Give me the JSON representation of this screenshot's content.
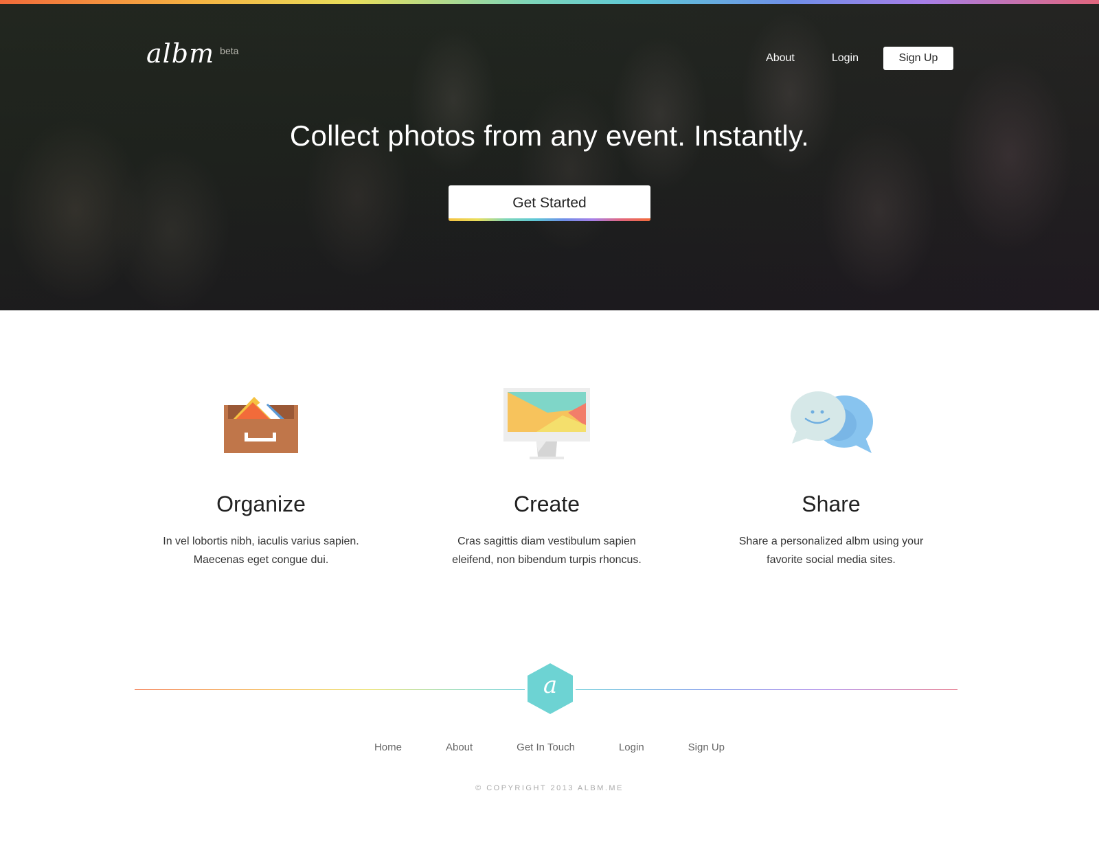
{
  "brand": {
    "name": "albm",
    "tag": "beta"
  },
  "nav": {
    "about": "About",
    "login": "Login",
    "signup": "Sign Up"
  },
  "hero": {
    "headline": "Collect photos from any event. Instantly.",
    "cta": "Get Started"
  },
  "features": [
    {
      "title": "Organize",
      "line1": "In vel lobortis nibh, iaculis varius sapien.",
      "line2": "Maecenas eget congue dui.",
      "icon": "photo-drawer-icon"
    },
    {
      "title": "Create",
      "line1": "Cras sagittis diam vestibulum sapien",
      "line2": "eleifend, non bibendum turpis rhoncus.",
      "icon": "monitor-icon"
    },
    {
      "title": "Share",
      "line1": "Share a personalized albm using your",
      "line2": "favorite social media sites.",
      "icon": "chat-bubbles-icon"
    }
  ],
  "footer": {
    "logo_letter": "a",
    "links": [
      "Home",
      "About",
      "Get In Touch",
      "Login",
      "Sign Up"
    ],
    "copyright": "© COPYRIGHT 2013 ALBM.ME"
  },
  "colors": {
    "hex": "#6dd3d3",
    "drawer": "#c0764a",
    "monitor_screen": "#f7c35c",
    "bubble_blue": "#88c4ef"
  }
}
